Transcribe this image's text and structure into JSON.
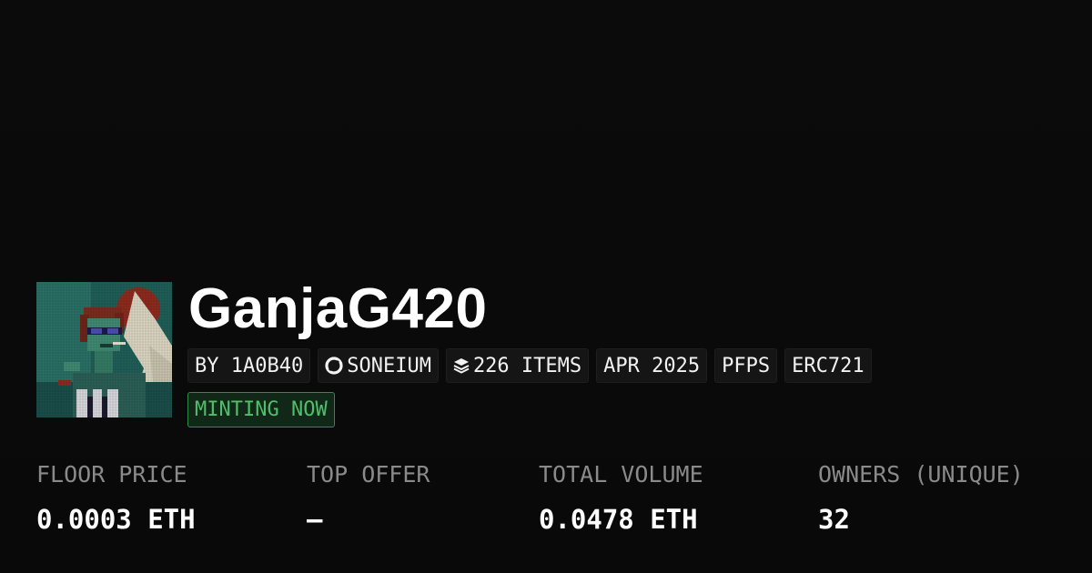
{
  "collection": {
    "name": "GanjaG420",
    "avatar_alt": "pixel-art-avatar"
  },
  "tags": {
    "creator": "BY 1A0B40",
    "chain": "SONEIUM",
    "items": "226 ITEMS",
    "date": "APR 2025",
    "category": "PFPS",
    "standard": "ERC721"
  },
  "status": "MINTING NOW",
  "stats": {
    "floor_label": "FLOOR PRICE",
    "floor_value": "0.0003 ETH",
    "offer_label": "TOP OFFER",
    "offer_value": "—",
    "volume_label": "TOTAL VOLUME",
    "volume_value": "0.0478 ETH",
    "owners_label": "OWNERS (UNIQUE)",
    "owners_value": "32"
  },
  "colors": {
    "background": "#0a0a0a",
    "tag_bg": "#151515",
    "status_text": "#4fbf6a",
    "status_border": "#2e8c46",
    "label_gray": "#8a8a8a"
  },
  "icons": {
    "chain": "soneium-logo-icon",
    "items": "layers-icon"
  }
}
